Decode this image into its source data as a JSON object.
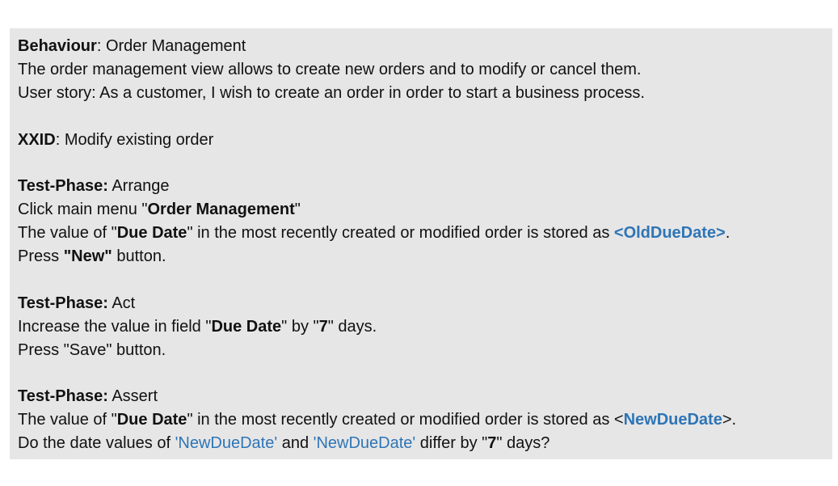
{
  "behaviour": {
    "label": "Behaviour",
    "sep": ": ",
    "value": "Order Management"
  },
  "description": "The order management view allows to create new orders and to modify or cancel them.",
  "user_story": "User story: As a customer, I wish to create an order in order to start a business process.",
  "xxid": {
    "label": "XXID",
    "sep": ":  ",
    "value": "Modify existing order"
  },
  "arrange": {
    "label": "Test-Phase:",
    "phase": " Arrange",
    "click_pre": "Click main menu \"",
    "click_menu": "Order Management",
    "click_post": "\"",
    "store_pre": "The value of \"",
    "store_field": "Due Date",
    "store_mid": "\" in the most recently created or modified order is stored as ",
    "store_var": "<OldDueDate>",
    "store_post": ".",
    "press_pre": "Press  ",
    "press_btn": "\"New\"",
    "press_post": " button."
  },
  "act": {
    "label": "Test-Phase:",
    "phase": " Act",
    "inc_pre": "Increase the value in field \"",
    "inc_field": "Due Date",
    "inc_mid": "\" by \"",
    "inc_num": "7",
    "inc_post": "\" days.",
    "save_line": "Press  \"Save\" button."
  },
  "assert": {
    "label": "Test-Phase:",
    "phase": " Assert",
    "store_pre": "The value of \"",
    "store_field": "Due Date",
    "store_mid": "\" in the most recently created or modified order is stored as <",
    "store_var": "NewDueDate",
    "store_post": ">.",
    "q_pre": "Do the date values of ",
    "q_var1": "'NewDueDate'",
    "q_mid": " and ",
    "q_var2": "'NewDueDate'",
    "q_mid2": " differ by \"",
    "q_num": "7",
    "q_post": "\" days?"
  }
}
